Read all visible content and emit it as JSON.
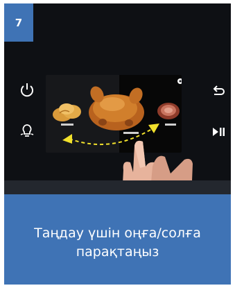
{
  "step": {
    "number": "7"
  },
  "instruction": {
    "line1": "Таңдау үшін оңға/солға",
    "line2": "парақтаңыз"
  },
  "icons": {
    "left_top": "power-icon",
    "left_bottom": "oven-light-icon",
    "right_top": "back-arrow-icon",
    "right_bottom": "play-pause-icon",
    "screen_top": "settings-gear-icon"
  },
  "colors": {
    "card_blue": "#3f73b5",
    "photo_dark": "#0e1014",
    "swipe_arrow": "#f2e12c"
  }
}
